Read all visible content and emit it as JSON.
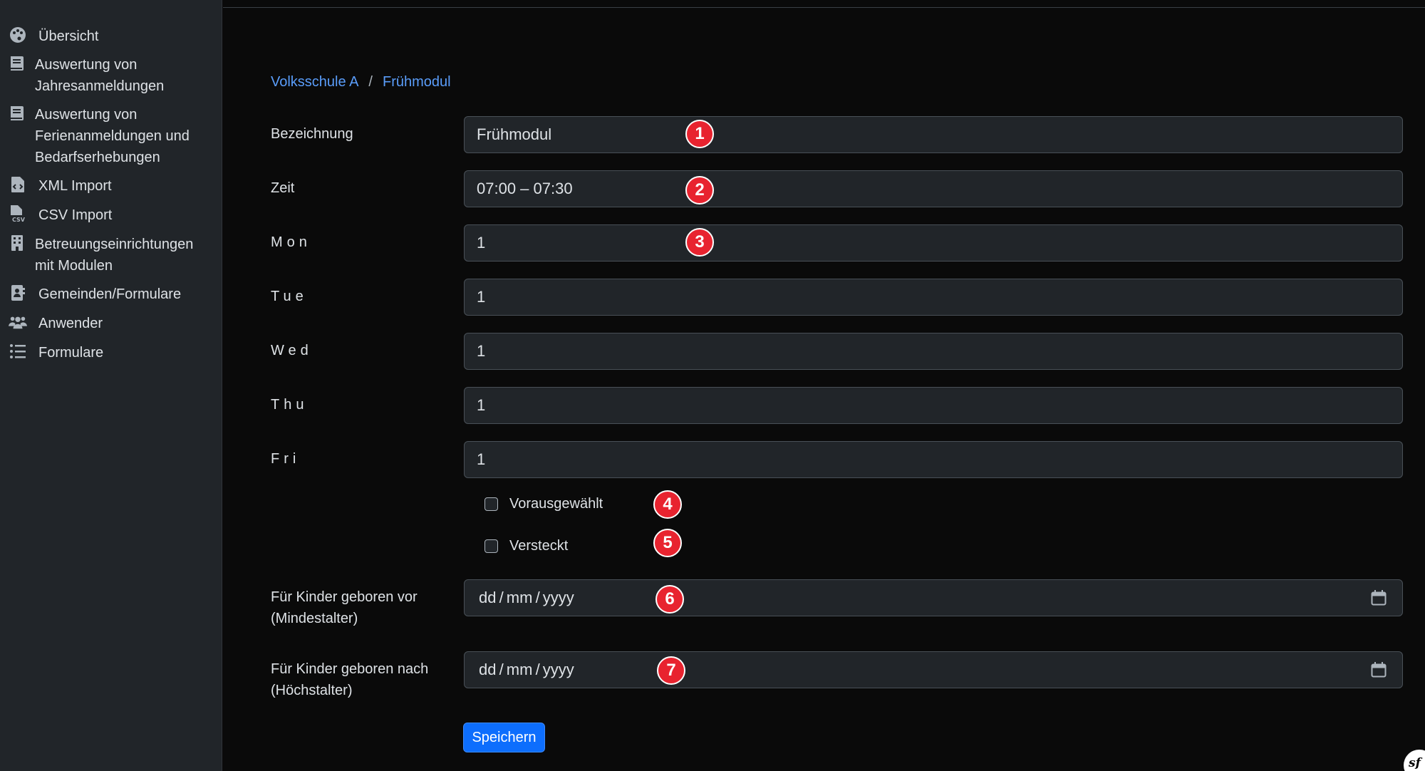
{
  "sidebar": {
    "items": [
      {
        "label": "Übersicht",
        "icon": "palette-icon"
      },
      {
        "label": "Auswertung von\nJahresanmeldungen",
        "icon": "book-icon"
      },
      {
        "label": "Auswertung von\nFerienanmeldungen und\nBedarfserhebungen",
        "icon": "book-icon"
      },
      {
        "label": "XML Import",
        "icon": "file-code-icon"
      },
      {
        "label": "CSV Import",
        "icon": "file-csv-icon"
      },
      {
        "label": "Betreuungseinrichtungen\nmit Modulen",
        "icon": "building-icon"
      },
      {
        "label": "Gemeinden/Formulare",
        "icon": "address-book-icon"
      },
      {
        "label": "Anwender",
        "icon": "users-icon"
      },
      {
        "label": "Formulare",
        "icon": "list-icon"
      }
    ]
  },
  "breadcrumb": {
    "items": [
      "Volksschule A",
      "Frühmodul"
    ],
    "separator": "/"
  },
  "form": {
    "bezeichnung": {
      "label": "Bezeichnung",
      "value": "Frühmodul"
    },
    "zeit": {
      "label": "Zeit",
      "value": "07:00 – 07:30"
    },
    "mon": {
      "label": "Mon",
      "value": "1"
    },
    "tue": {
      "label": "Tue",
      "value": "1"
    },
    "wed": {
      "label": "Wed",
      "value": "1"
    },
    "thu": {
      "label": "Thu",
      "value": "1"
    },
    "fri": {
      "label": "Fri",
      "value": "1"
    },
    "vorausgewaehlt": {
      "label": "Vorausgewählt",
      "checked": false
    },
    "versteckt": {
      "label": "Versteckt",
      "checked": false
    },
    "mindestalter": {
      "label": "Für Kinder geboren vor\n(Mindestalter)",
      "placeholder": "dd / mm / yyyy"
    },
    "hoechstalter": {
      "label": "Für Kinder geboren nach\n(Höchstalter)",
      "placeholder": "dd / mm / yyyy"
    },
    "save_label": "Speichern"
  },
  "annotations": [
    "1",
    "2",
    "3",
    "4",
    "5",
    "6",
    "7"
  ],
  "corner_logo": "sf",
  "colors": {
    "background": "#0a0a0a",
    "sidebar": "#212529",
    "input_bg": "#212529",
    "link": "#5a9dfa",
    "primary": "#0d6efd",
    "badge": "#e8232f"
  }
}
